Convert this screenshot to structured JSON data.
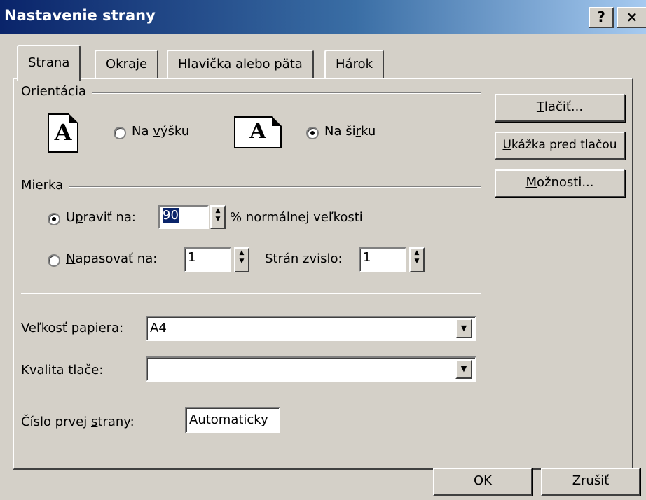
{
  "window": {
    "title": "Nastavenie strany",
    "help_button": "?",
    "close_button": "×"
  },
  "tabs": [
    "Strana",
    "Okraje",
    "Hlavička alebo päta",
    "Hárok"
  ],
  "orientation": {
    "group_label": "Orientácia",
    "portrait_icon": "A",
    "landscape_icon": "A",
    "portrait_label_pre": "Na ",
    "portrait_label_u": "v",
    "portrait_label_post": "ýšku",
    "landscape_label_pre": "Na ši",
    "landscape_label_u": "r",
    "landscape_label_post": "ku",
    "selected": "landscape"
  },
  "scale": {
    "group_label": "Mierka",
    "adjust_pre": "U",
    "adjust_u": "p",
    "adjust_post": "raviť na:",
    "adjust_value": "90",
    "adjust_suffix": "% normálnej veľkosti",
    "fit_pre": "",
    "fit_u": "N",
    "fit_post": "apasovať na:",
    "fit_wide_value": "1",
    "pages_tall_label": "Strán zvislo:",
    "fit_tall_value": "1",
    "selected": "adjust"
  },
  "paper": {
    "size_pre": "Ve",
    "size_u": "ľ",
    "size_post": "kosť papiera:",
    "size_value": "A4",
    "quality_u": "K",
    "quality_post": "valita tlače:",
    "quality_value": "",
    "first_page_pre": "Číslo prvej ",
    "first_page_u": "s",
    "first_page_post": "trany:",
    "first_page_value": "Automaticky"
  },
  "side_buttons": {
    "print_u": "T",
    "print_post": "lačiť...",
    "preview_u": "U",
    "preview_post": "kážka pred tlačou",
    "options_u": "M",
    "options_post": "ožnosti..."
  },
  "footer": {
    "ok": "OK",
    "cancel": "Zrušiť"
  },
  "icons": [
    "help-icon",
    "close-icon",
    "portrait-orientation-icon",
    "landscape-orientation-icon",
    "spin-up-icon",
    "spin-down-icon",
    "dropdown-arrow-icon"
  ]
}
